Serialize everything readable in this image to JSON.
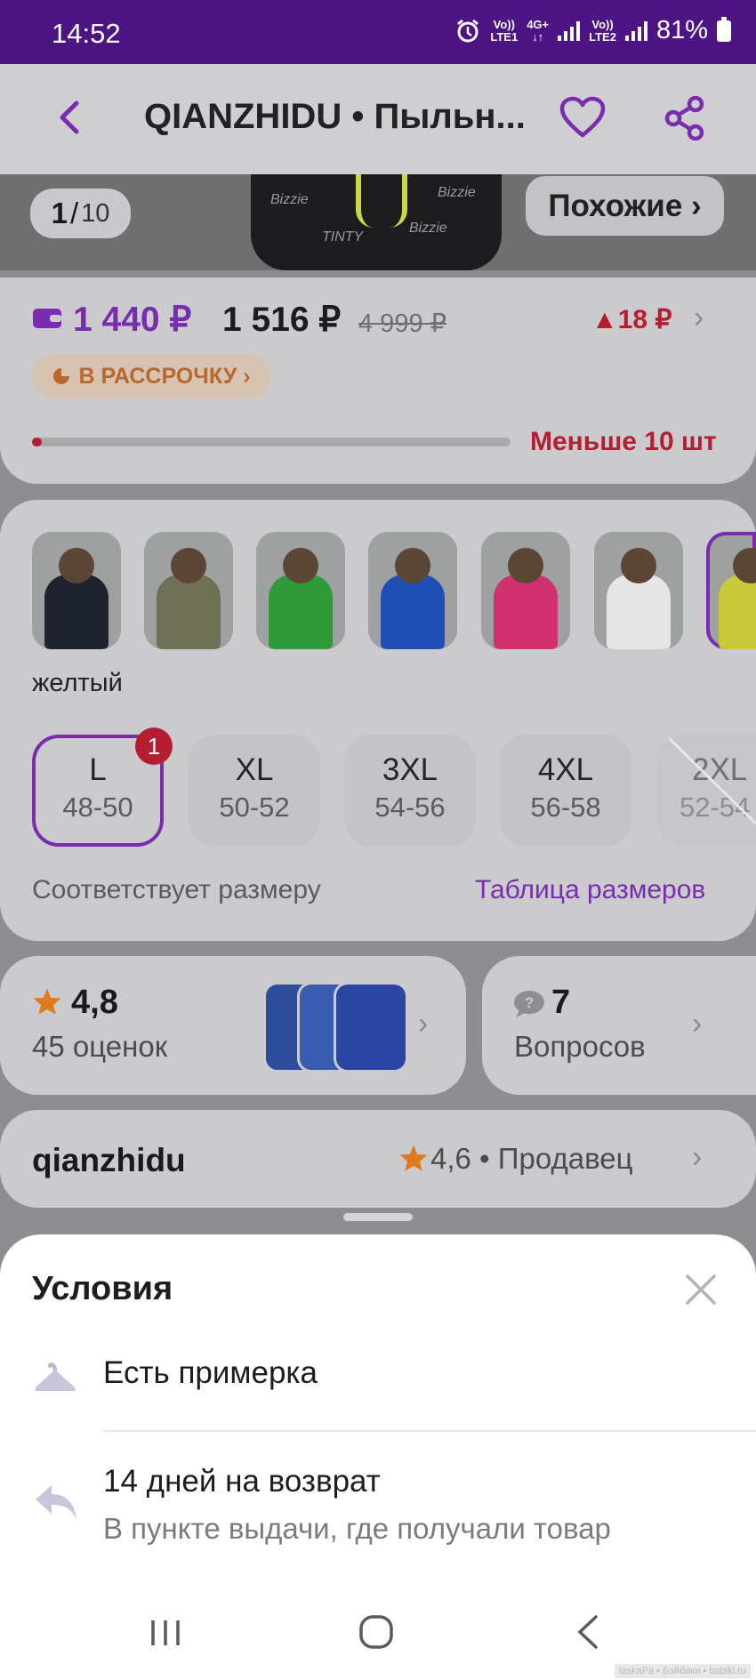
{
  "status_bar": {
    "time": "14:52",
    "sim1_top": "Vo))",
    "sim1_bottom": "LTE1",
    "data_top": "4G+",
    "data_bottom": "↓↑",
    "sim2_top": "Vo))",
    "sim2_bottom": "LTE2",
    "battery": "81%"
  },
  "header": {
    "title": "QIANZHIDU • Пыльн..."
  },
  "gallery": {
    "current": "1",
    "separator": "/",
    "total": "10",
    "similar_label": "Похожие ›",
    "jacket_prints": [
      "Bizzie",
      "TINTY",
      "Bizzie",
      "Bizzie"
    ]
  },
  "price": {
    "wallet_price": "1 440 ₽",
    "regular_price": "1 516 ₽",
    "old_price": "4 999 ₽",
    "delta": "▲18 ₽",
    "installment_label": "В РАССРОЧКУ ›",
    "stock_label": "Меньше 10 шт",
    "stock_fraction": 0.02
  },
  "colors": {
    "selected_label": "желтый",
    "items": [
      {
        "name": "black",
        "hex": "#1f2330"
      },
      {
        "name": "olive",
        "hex": "#6f7157"
      },
      {
        "name": "green",
        "hex": "#2f9a3a"
      },
      {
        "name": "blue",
        "hex": "#1f4fb5"
      },
      {
        "name": "pink",
        "hex": "#d1306e"
      },
      {
        "name": "white",
        "hex": "#e6e6e6"
      },
      {
        "name": "yellow",
        "hex": "#c9c93a"
      }
    ]
  },
  "sizes": {
    "items": [
      {
        "size": "L",
        "range": "48-50",
        "selected": true,
        "badge": "1"
      },
      {
        "size": "XL",
        "range": "50-52"
      },
      {
        "size": "3XL",
        "range": "54-56"
      },
      {
        "size": "4XL",
        "range": "56-58"
      },
      {
        "size": "2XL",
        "range": "52-54",
        "disabled": true
      }
    ],
    "fit_note": "Соответствует размеру",
    "size_table_link": "Таблица размеров"
  },
  "reviews": {
    "rating": "4,8",
    "count_label": "45 оценок"
  },
  "questions": {
    "count": "7",
    "label": "Вопросов"
  },
  "seller": {
    "name": "qianzhidu",
    "rating_label": "4,6 • Продавец"
  },
  "conditions_sheet": {
    "title": "Условия",
    "fitting_label": "Есть примерка",
    "return_title": "14 дней на возврат",
    "return_subtitle": "В пункте выдачи, где получали товар"
  },
  "watermark": "laskaPa • Бэйбики • babiki.ru",
  "accent_colors": {
    "brand_purple": "#7a2cb0",
    "status_bar": "#4d1484",
    "alert_red": "#b51d31",
    "rating_star": "#e07a1f"
  }
}
